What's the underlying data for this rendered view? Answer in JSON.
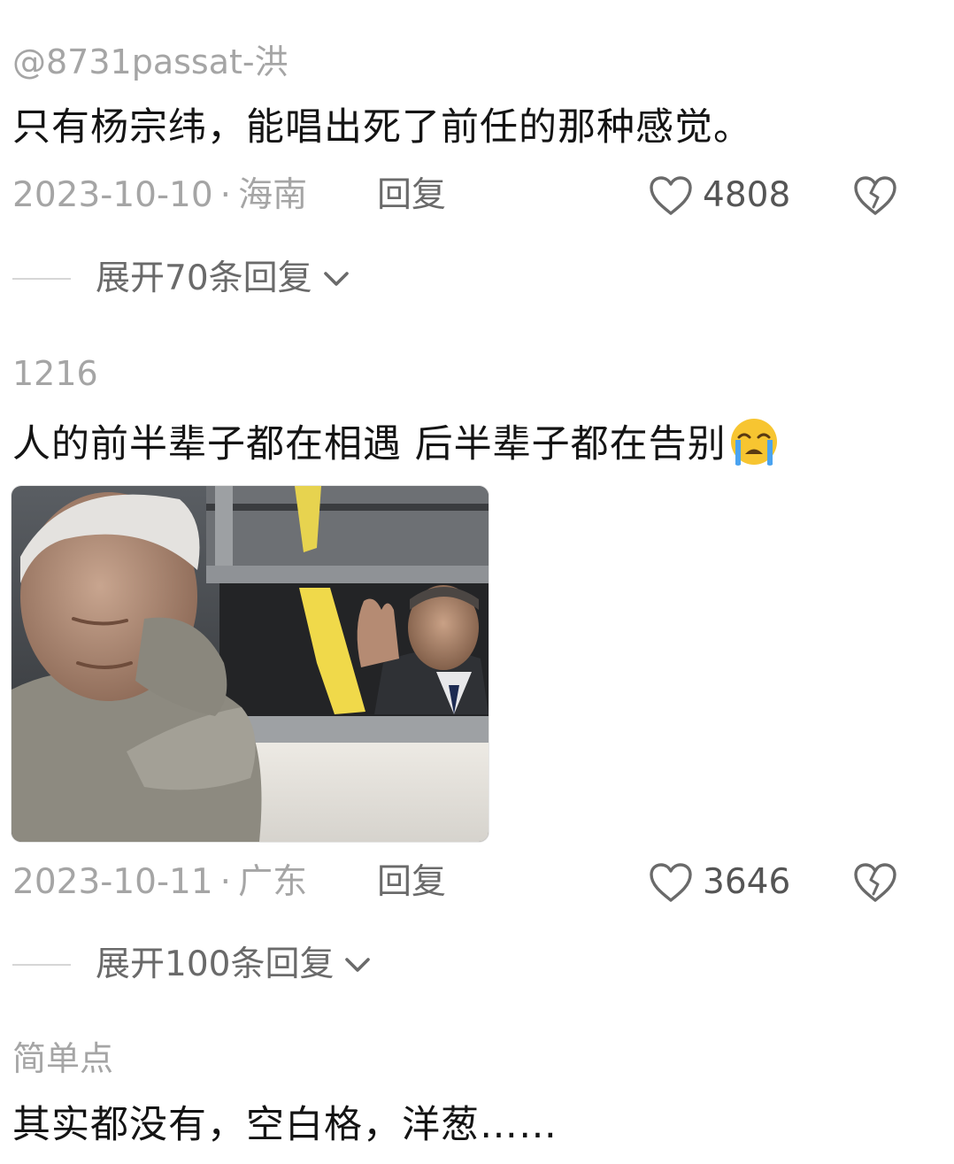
{
  "comments": [
    {
      "username": "@8731passat-洪",
      "text": "只有杨宗纬，能唱出死了前任的那种感觉。",
      "date": "2023-10-10",
      "separator": "·",
      "location": "海南",
      "reply_label": "回复",
      "likes": "4808",
      "expand_label": "展开70条回复"
    },
    {
      "username": "1216",
      "text": "人的前半辈子都在相遇 后半辈子都在告别",
      "emoji": "crying-face-icon",
      "has_photo": true,
      "date": "2023-10-11",
      "separator": "·",
      "location": "广东",
      "reply_label": "回复",
      "likes": "3646",
      "expand_label": "展开100条回复"
    },
    {
      "username": "简单点",
      "text": "其实都没有，空白格，洋葱……"
    }
  ],
  "colors": {
    "meta_gray": "#a5a5a5",
    "text": "#141414",
    "icon_gray": "#6a6a6a",
    "emoji_yellow": "#f7c531",
    "tear_blue": "#4aa3f0"
  }
}
